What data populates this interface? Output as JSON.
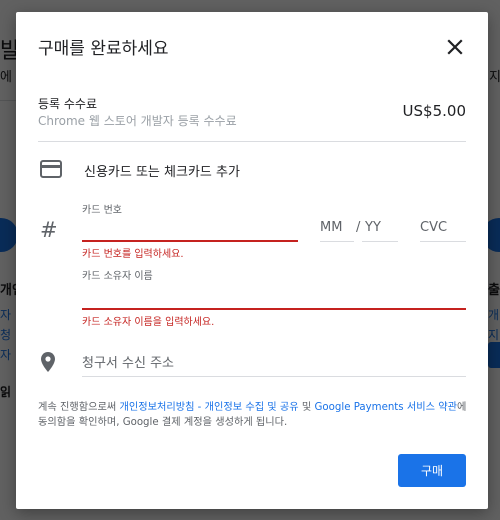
{
  "colors": {
    "accent": "#1a73e8",
    "error": "#c5221f",
    "overlay": "rgba(0,0,0,0.62)"
  },
  "background": {
    "fragments": [
      "발",
      "에",
      "개인",
      "자",
      "청",
      "자",
      "읽",
      "출",
      "개",
      "지",
      "지"
    ]
  },
  "dialog": {
    "title": "구매를 완료하세요",
    "close_icon": "close-icon",
    "fee": {
      "label": "등록 수수료",
      "sublabel": "Chrome 웹 스토어 개발자 등록 수수료",
      "price": "US$5.00"
    },
    "card_section": {
      "icon": "credit-card-icon",
      "title": "신용카드 또는 체크카드 추가"
    },
    "card_number": {
      "icon": "hash-icon",
      "label": "카드 번호",
      "value": "",
      "error": "카드 번호를 입력하세요."
    },
    "expiry": {
      "month_placeholder": "MM",
      "separator": "/",
      "year_placeholder": "YY"
    },
    "cvc_placeholder": "CVC",
    "cardholder": {
      "label": "카드 소유자 이름",
      "value": "",
      "error": "카드 소유자 이름을 입력하세요."
    },
    "billing": {
      "icon": "location-pin-icon",
      "placeholder": "청구서 수신 주소"
    },
    "terms": {
      "prefix": "계속 진행함으로써 ",
      "link1": "개인정보처리방침 - 개인정보 수집 및 공유",
      "middle": " 및 ",
      "link2": "Google Payments 서비스 약관",
      "suffix": "에 동의함을 확인하며, Google 결제 계정을 생성하게 됩니다."
    },
    "buy_button": "구매"
  }
}
